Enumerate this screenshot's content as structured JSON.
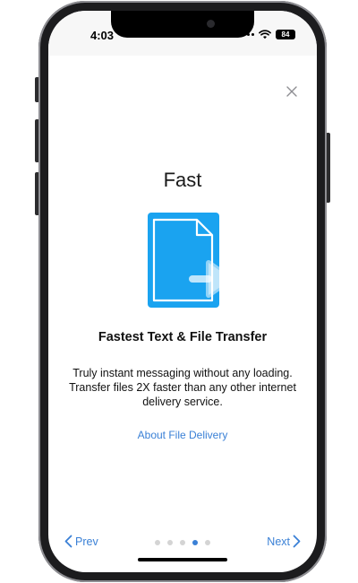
{
  "status_bar": {
    "time": "4:03",
    "battery": "84",
    "icons": [
      "cellular-icon",
      "wifi-icon",
      "battery-icon"
    ]
  },
  "onboarding": {
    "close_icon": "close-icon",
    "title": "Fast",
    "illustration_icon": "file-transfer-icon",
    "subtitle": "Fastest Text & File Transfer",
    "description": "Truly instant messaging without any loading. Transfer files 2X faster than any other internet delivery service.",
    "link_label": "About File Delivery"
  },
  "navigation": {
    "prev_label": "Prev",
    "next_label": "Next",
    "page_count": 5,
    "current_page": 4
  },
  "colors": {
    "accent": "#3a80d6",
    "illustration_blue": "#1aa3f0",
    "dot_inactive": "#d4d4d4"
  }
}
